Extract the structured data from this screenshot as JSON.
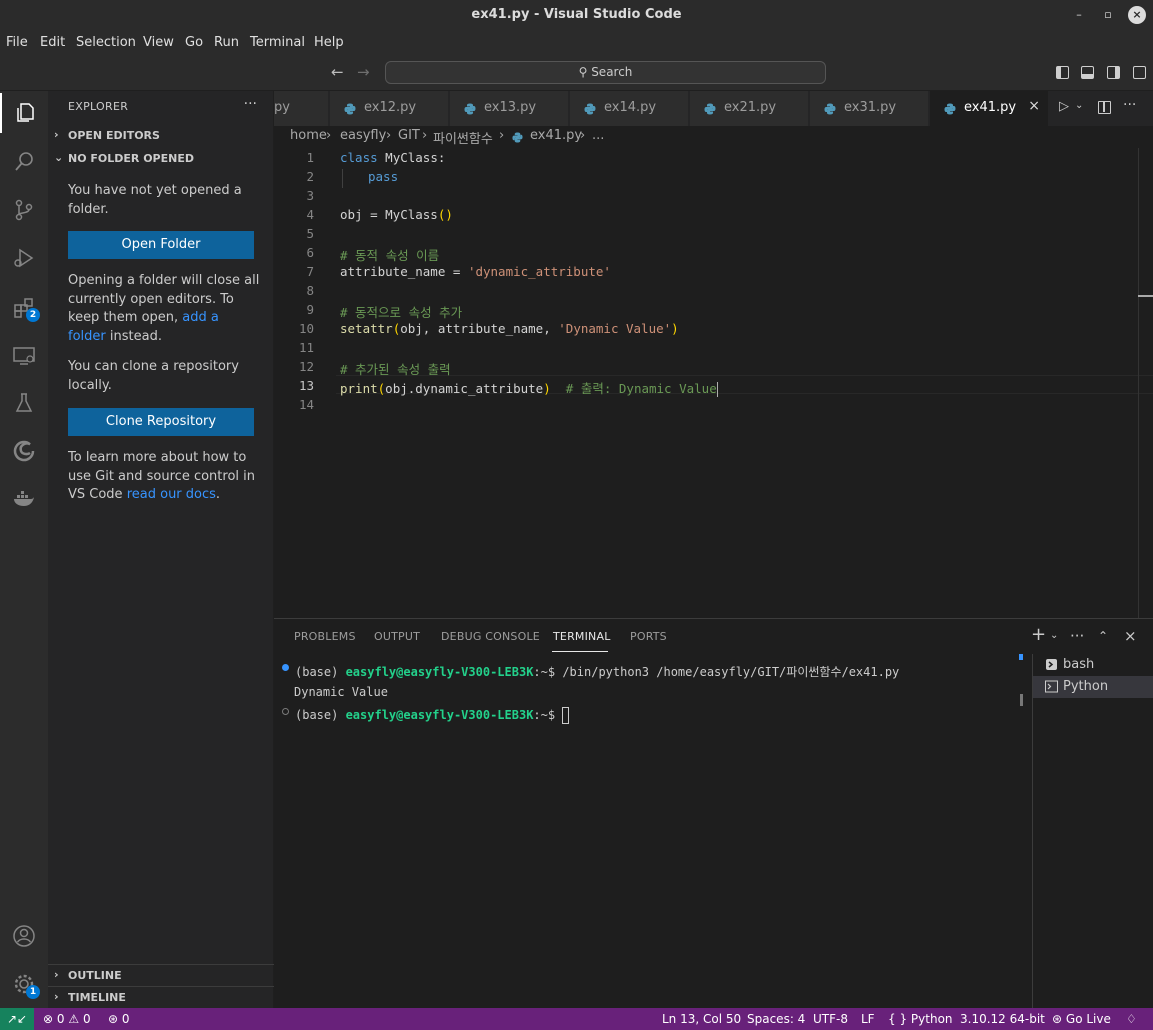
{
  "window": {
    "title": "ex41.py - Visual Studio Code"
  },
  "menu": [
    "File",
    "Edit",
    "Selection",
    "View",
    "Go",
    "Run",
    "Terminal",
    "Help"
  ],
  "command_center": {
    "search_label": "Search"
  },
  "activity_badges": {
    "extensions": "2",
    "manage": "1"
  },
  "sidebar": {
    "header": "EXPLORER",
    "more": "···",
    "open_editors": "OPEN EDITORS",
    "no_folder": "NO FOLDER OPENED",
    "msg1": "You have not yet opened a folder.",
    "open_folder_button": "Open Folder",
    "msg2_pre": "Opening a folder will close all currently open editors. To keep them open,",
    "msg2_link": "add a folder",
    "msg2_post": "instead.",
    "msg3": "You can clone a repository locally.",
    "clone_button": "Clone Repository",
    "msg4_pre": "To learn more about how to use Git and source control in VS Code",
    "msg4_link": "read our docs",
    "msg4_post": ".",
    "outline": "OUTLINE",
    "timeline": "TIMELINE"
  },
  "tabs": [
    "py",
    "ex12.py",
    "ex13.py",
    "ex14.py",
    "ex21.py",
    "ex31.py",
    "ex41.py"
  ],
  "active_tab": "ex41.py",
  "breadcrumb": [
    "home",
    "easyfly",
    "GIT",
    "파이썬함수",
    "ex41.py",
    "..."
  ],
  "editor": {
    "line_numbers": [
      "1",
      "2",
      "3",
      "4",
      "5",
      "6",
      "7",
      "8",
      "9",
      "10",
      "11",
      "12",
      "13",
      "14"
    ],
    "current_line": "13",
    "lines": {
      "l1_kw": "class",
      "l1_rest": " MyClass:",
      "l2_kw": "pass",
      "l4_a": "obj = MyClass",
      "l4_p": "()",
      "l6": "# 동적 속성 이름",
      "l7_a": "attribute_name = ",
      "l7_s": "'dynamic_attribute'",
      "l9": "# 동적으로 속성 추가",
      "l10_fn": "setattr",
      "l10_p1": "(",
      "l10_a": "obj, attribute_name, ",
      "l10_s": "'Dynamic Value'",
      "l10_p2": ")",
      "l12": "# 추가된 속성 출력",
      "l13_fn": "print",
      "l13_p1": "(",
      "l13_a": "obj.dynamic_attribute",
      "l13_p2": ")",
      "l13_c": "  # 출력: Dynamic Value"
    }
  },
  "panel": {
    "tabs": [
      "PROBLEMS",
      "OUTPUT",
      "DEBUG CONSOLE",
      "TERMINAL",
      "PORTS"
    ],
    "active": "TERMINAL",
    "terminal": {
      "l1_base": "(base) ",
      "l1_user": "easyfly@easyfly-V300-LEB3K",
      "l1_rest": ":~$ /bin/python3 /home/easyfly/GIT/파이썬함수/ex41.py",
      "l2": "Dynamic Value",
      "l3_base": "(base) ",
      "l3_user": "easyfly@easyfly-V300-LEB3K",
      "l3_rest": ":~$ "
    },
    "terminal_list": [
      "bash",
      "Python"
    ]
  },
  "statusbar": {
    "errors": "0",
    "warnings": "0",
    "ports": "0",
    "position": "Ln 13, Col 50",
    "spaces": "Spaces: 4",
    "encoding": "UTF-8",
    "eol": "LF",
    "language": "Python",
    "interpreter": "3.10.12 64-bit",
    "golive": "Go Live"
  },
  "colors": {
    "statusbar": "#68217a",
    "remote": "#16825d",
    "button": "#0e639c",
    "accent": "#0078d4"
  }
}
